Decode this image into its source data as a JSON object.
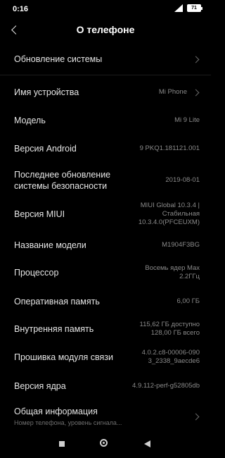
{
  "status": {
    "time": "0:16",
    "battery": "71"
  },
  "header": {
    "title": "О телефоне"
  },
  "items": [
    {
      "label": "Обновление системы",
      "value": ""
    },
    {
      "label": "Имя устройства",
      "value": "Mi Phone"
    },
    {
      "label": "Модель",
      "value": "Mi 9 Lite"
    },
    {
      "label": "Версия Android",
      "value": "9 PKQ1.181121.001"
    },
    {
      "label": "Последнее обновление системы безопасности",
      "value": "2019-08-01"
    },
    {
      "label": "Версия MIUI",
      "value": "MIUI Global 10.3.4 | Стабильная 10.3.4.0(PFCEUXM)"
    },
    {
      "label": "Название модели",
      "value": "M1904F3BG"
    },
    {
      "label": "Процессор",
      "value": "Восемь ядер Max 2.2ГГц"
    },
    {
      "label": "Оперативная память",
      "value": "6,00 ГБ"
    },
    {
      "label": "Внутренняя память",
      "value": "115,62 ГБ доступно 128,00 ГБ всего"
    },
    {
      "label": "Прошивка модуля связи",
      "value": "4.0.2.c8-00006-0903_2338_9aecde6"
    },
    {
      "label": "Версия ядра",
      "value": "4.9.112-perf-g52805db"
    },
    {
      "label": "Общая информация",
      "sub": "Номер телефона, уровень сигнала..."
    }
  ]
}
